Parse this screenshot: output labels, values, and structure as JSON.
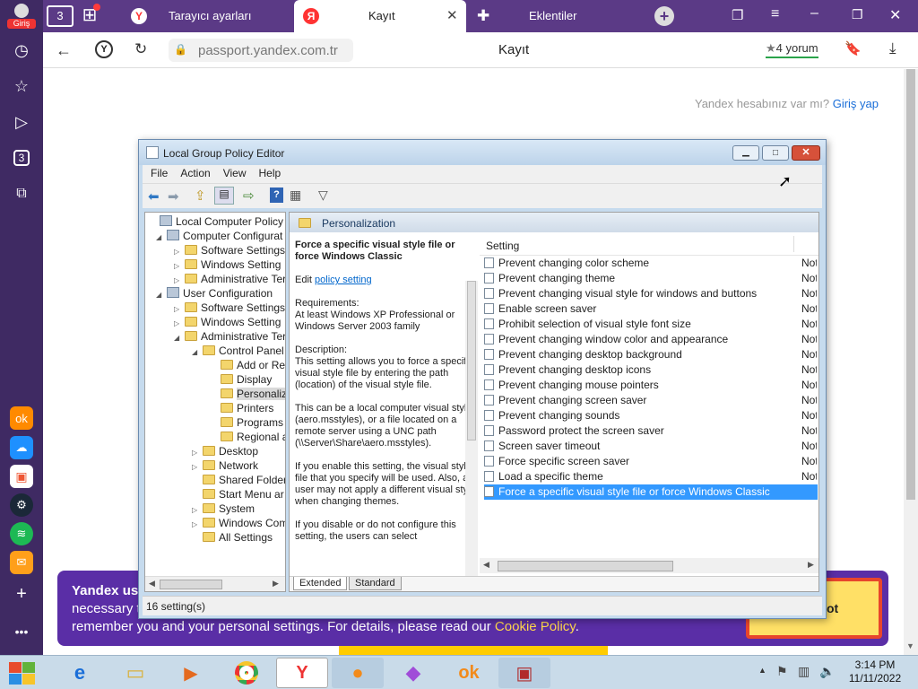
{
  "browser": {
    "profile_label": "Giriş",
    "tab_count": "3",
    "tabs": [
      {
        "label": "Tarayıcı ayarları",
        "favicon": "yandex-icon"
      },
      {
        "label": "Kayıt",
        "favicon": "yandex-icon",
        "active": true
      },
      {
        "label": "Eklentiler",
        "favicon": "puzzle-icon"
      }
    ],
    "address": "passport.yandex.com.tr",
    "page_title": "Kayıt",
    "reviews": "4 yorum",
    "sidebar_badge": "3"
  },
  "page": {
    "login_prompt": "Yandex hesabınız var mı?",
    "login_link": "Giriş yap"
  },
  "cookie": {
    "line1": "Yandex us",
    "line2": "necessary t",
    "line3_prefix": "remember you and your personal settings. For details, please read our ",
    "line3_link": "Cookie Policy",
    "line3_suffix": ".",
    "button_fragment": "ot"
  },
  "gpo": {
    "title": "Local Group Policy Editor",
    "menu": [
      "File",
      "Action",
      "View",
      "Help"
    ],
    "tree": [
      {
        "label": "Local Computer Policy",
        "indent": 0
      },
      {
        "label": "Computer Configurat",
        "indent": 1
      },
      {
        "label": "Software Settings",
        "indent": 2
      },
      {
        "label": "Windows Setting",
        "indent": 2
      },
      {
        "label": "Administrative Ter",
        "indent": 2
      },
      {
        "label": "User Configuration",
        "indent": 1
      },
      {
        "label": "Software Settings",
        "indent": 2
      },
      {
        "label": "Windows Setting",
        "indent": 2
      },
      {
        "label": "Administrative Ter",
        "indent": 2
      },
      {
        "label": "Control Panel",
        "indent": 3
      },
      {
        "label": "Add or Re",
        "indent": 4
      },
      {
        "label": "Display",
        "indent": 4
      },
      {
        "label": "Personaliz",
        "indent": 4
      },
      {
        "label": "Printers",
        "indent": 4
      },
      {
        "label": "Programs",
        "indent": 4
      },
      {
        "label": "Regional a",
        "indent": 4
      },
      {
        "label": "Desktop",
        "indent": 3
      },
      {
        "label": "Network",
        "indent": 3
      },
      {
        "label": "Shared Folder",
        "indent": 3
      },
      {
        "label": "Start Menu ar",
        "indent": 3
      },
      {
        "label": "System",
        "indent": 3
      },
      {
        "label": "Windows Com",
        "indent": 3
      },
      {
        "label": "All Settings",
        "indent": 3
      }
    ],
    "section_header": "Personalization",
    "policy_title": "Force a specific visual style file or force Windows Classic",
    "edit_prefix": "Edit",
    "edit_link": "policy setting",
    "requirements_label": "Requirements:",
    "requirements_text": "At least Windows XP Professional or Windows Server 2003 family",
    "description_label": "Description:",
    "description_p1": "This setting allows you to force a specific visual style file by entering the path (location) of the visual style file.",
    "description_p2": "This can be a local computer visual style (aero.msstyles), or a file located on a remote server using a UNC path (\\\\Server\\Share\\aero.msstyles).",
    "description_p3": "If you enable this setting, the visual style file that you specify will be used. Also, a user may not apply a different visual style when changing themes.",
    "description_p4": "If you disable or do not configure this setting, the users can select",
    "column_setting": "Setting",
    "settings": [
      {
        "name": "Prevent changing color scheme",
        "state": "Not"
      },
      {
        "name": "Prevent changing theme",
        "state": "Not"
      },
      {
        "name": "Prevent changing visual style for windows and buttons",
        "state": "Not"
      },
      {
        "name": "Enable screen saver",
        "state": "Not"
      },
      {
        "name": "Prohibit selection of visual style font size",
        "state": "Not"
      },
      {
        "name": "Prevent changing window color and appearance",
        "state": "Not"
      },
      {
        "name": "Prevent changing desktop background",
        "state": "Not"
      },
      {
        "name": "Prevent changing desktop icons",
        "state": "Not"
      },
      {
        "name": "Prevent changing mouse pointers",
        "state": "Not"
      },
      {
        "name": "Prevent changing screen saver",
        "state": "Not"
      },
      {
        "name": "Prevent changing sounds",
        "state": "Not"
      },
      {
        "name": "Password protect the screen saver",
        "state": "Not"
      },
      {
        "name": "Screen saver timeout",
        "state": "Not"
      },
      {
        "name": "Force specific screen saver",
        "state": "Not"
      },
      {
        "name": "Load a specific theme",
        "state": "Not"
      },
      {
        "name": "Force a specific visual style file or force Windows Classic",
        "state": "",
        "selected": true
      }
    ],
    "tabs": [
      "Extended",
      "Standard"
    ],
    "status": "16 setting(s)"
  },
  "taskbar": {
    "time": "3:14 PM",
    "date": "11/11/2022"
  },
  "colors": {
    "browser_tab": "#5b3a86",
    "sidebar": "#3f2a63",
    "selection": "#3399ff",
    "link": "#0066cc",
    "cookie_bg": "#5a2ea6",
    "cookie_link": "#ffd84d"
  }
}
